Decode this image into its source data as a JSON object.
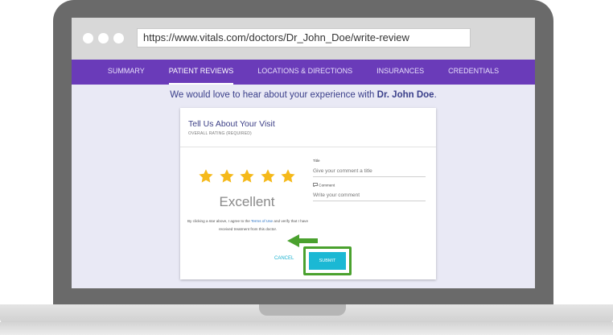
{
  "browser": {
    "url": "https://www.vitals.com/doctors/Dr_John_Doe/write-review"
  },
  "nav": {
    "items": [
      {
        "label": "SUMMARY",
        "active": false
      },
      {
        "label": "PATIENT REVIEWS",
        "active": true
      },
      {
        "label": "LOCATIONS & DIRECTIONS",
        "active": false
      },
      {
        "label": "INSURANCES",
        "active": false
      },
      {
        "label": "CREDENTIALS",
        "active": false
      }
    ]
  },
  "headline": {
    "prefix": "We would love to hear about your experience with ",
    "doctor": "Dr. John Doe",
    "suffix": "."
  },
  "review_card": {
    "title": "Tell Us About Your Visit",
    "subtitle": "OVERALL RATING (REQUIRED)",
    "rating": {
      "value": 5,
      "max": 5,
      "label": "Excellent"
    },
    "terms": {
      "before": "By clicking a star above, I agree to the ",
      "link": "Terms of Use",
      "after": " and verify that I have received treatment from this doctor."
    },
    "title_field": {
      "label": "Title",
      "placeholder": "Give your comment a title"
    },
    "comment_field": {
      "label": "Comment",
      "placeholder": "Write your comment"
    },
    "cancel_label": "CANCEL",
    "submit_label": "SUBMIT"
  },
  "colors": {
    "nav_background": "#6a3bb9",
    "star": "#f5b91a",
    "submit": "#1bb8d4",
    "highlight": "#4aa12e"
  }
}
